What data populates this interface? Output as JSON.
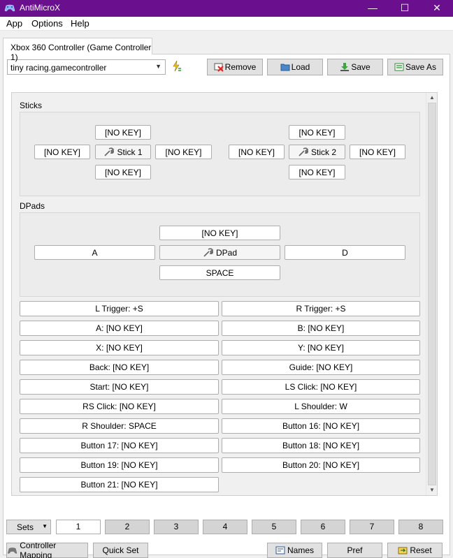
{
  "window": {
    "title": "AntiMicroX",
    "minimize": "—",
    "maximize": "☐",
    "close": "✕"
  },
  "menu": [
    "App",
    "Options",
    "Help"
  ],
  "tab": {
    "label": "Xbox 360 Controller (Game Controller 1)"
  },
  "profile": {
    "selected": "tiny racing.gamecontroller"
  },
  "toolbar": {
    "remove": "Remove",
    "load": "Load",
    "save": "Save",
    "save_as": "Save As"
  },
  "sections": {
    "sticks": "Sticks",
    "dpads": "DPads"
  },
  "stick1": {
    "up": "[NO KEY]",
    "left": "[NO KEY]",
    "center": "Stick 1",
    "right": "[NO KEY]",
    "down": "[NO KEY]"
  },
  "stick2": {
    "up": "[NO KEY]",
    "left": "[NO KEY]",
    "center": "Stick 2",
    "right": "[NO KEY]",
    "down": "[NO KEY]"
  },
  "dpad": {
    "up": "[NO KEY]",
    "left": "A",
    "center": "DPad",
    "right": "D",
    "down": "SPACE"
  },
  "buttons": [
    "L Trigger: +S",
    "R Trigger: +S",
    "A: [NO KEY]",
    "B: [NO KEY]",
    "X: [NO KEY]",
    "Y: [NO KEY]",
    "Back: [NO KEY]",
    "Guide: [NO KEY]",
    "Start: [NO KEY]",
    "LS Click: [NO KEY]",
    "RS Click: [NO KEY]",
    "L Shoulder: W",
    "R Shoulder: SPACE",
    "Button 16: [NO KEY]",
    "Button 17: [NO KEY]",
    "Button 18: [NO KEY]",
    "Button 19: [NO KEY]",
    "Button 20: [NO KEY]",
    "Button 21: [NO KEY]"
  ],
  "sets": {
    "label": "Sets",
    "tabs": [
      "1",
      "2",
      "3",
      "4",
      "5",
      "6",
      "7",
      "8"
    ],
    "active": "1"
  },
  "bottom": {
    "controller_mapping": "Controller Mapping",
    "quick_set": "Quick Set",
    "names": "Names",
    "pref": "Pref",
    "reset": "Reset"
  },
  "colors": {
    "titlebar": "#6a0f8e",
    "panel": "#ffffff",
    "group": "#ececec"
  },
  "icons": {
    "app": "gamepad-icon",
    "plug": "lightning-plug-icon",
    "remove": "remove-profile-icon",
    "load": "folder-icon",
    "save": "save-download-icon",
    "save_as": "save-as-icon",
    "stick": "wrench-icon",
    "names": "names-keyboard-icon",
    "reset": "reset-arrow-icon"
  }
}
